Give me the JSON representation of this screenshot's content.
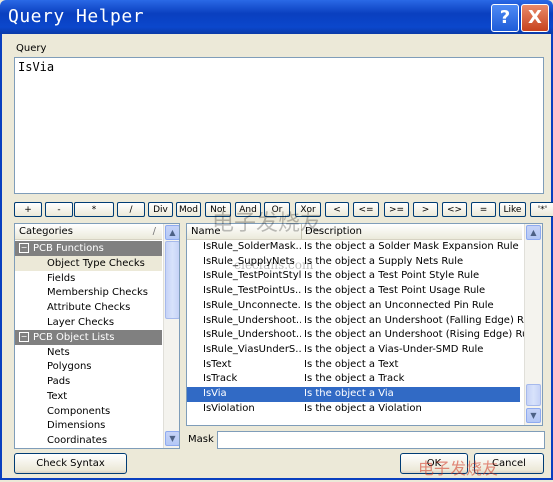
{
  "window": {
    "title": "Query Helper",
    "help_glyph": "?",
    "close_glyph": "X"
  },
  "query": {
    "label": "Query",
    "value": "IsVia"
  },
  "operators": [
    "+",
    "-",
    "*",
    "/",
    "Div",
    "Mod",
    "Not",
    "And",
    "Or",
    "Xor",
    "<",
    "<=",
    ">=",
    ">",
    "<>",
    "=",
    "Like",
    "'*'"
  ],
  "categories": {
    "header": "Categories",
    "groups": [
      {
        "label": "PCB Functions",
        "expander": "−",
        "items": [
          "Object Type Checks",
          "Fields",
          "Membership Checks",
          "Attribute Checks",
          "Layer Checks"
        ]
      },
      {
        "label": "PCB Object Lists",
        "expander": "−",
        "items": [
          "Nets",
          "Polygons",
          "Pads",
          "Text",
          "Components",
          "Dimensions",
          "Coordinates"
        ]
      }
    ],
    "selected": "Object Type Checks"
  },
  "functions": {
    "col_name": "Name",
    "col_desc": "Description",
    "rows": [
      {
        "name": "IsRule_SolderMask...",
        "desc": "Is the object a Solder Mask Expansion Rule"
      },
      {
        "name": "IsRule_SupplyNets",
        "desc": "Is the object a Supply Nets Rule"
      },
      {
        "name": "IsRule_TestPointStyle",
        "desc": "Is the object a Test Point Style Rule"
      },
      {
        "name": "IsRule_TestPointUs...",
        "desc": "Is the object a Test Point Usage Rule"
      },
      {
        "name": "IsRule_Unconnecte...",
        "desc": "Is the object an Unconnected Pin Rule"
      },
      {
        "name": "IsRule_Undershoot...",
        "desc": "Is the object an Undershoot (Falling Edge) Rule"
      },
      {
        "name": "IsRule_Undershoot...",
        "desc": "Is the object an Undershoot (Rising Edge) Rule"
      },
      {
        "name": "IsRule_ViasUnderS...",
        "desc": "Is the object a Vias-Under-SMD Rule"
      },
      {
        "name": "IsText",
        "desc": "Is the object a Text"
      },
      {
        "name": "IsTrack",
        "desc": "Is the object a Track"
      },
      {
        "name": "IsVia",
        "desc": "Is the object a Via"
      },
      {
        "name": "IsViolation",
        "desc": "Is the object a Violation"
      }
    ],
    "selected_index": 10
  },
  "mask": {
    "label": "Mask",
    "value": ""
  },
  "buttons": {
    "check_syntax": "Check Syntax",
    "ok": "OK",
    "cancel": "Cancel"
  },
  "icons": {
    "scroll_up": "up-arrow-icon",
    "scroll_down": "down-arrow-icon",
    "dropdown": "chevron-down-icon"
  },
  "colors": {
    "title_bar": "#0a3fbf",
    "selection": "#316ac5",
    "group_header": "#808080",
    "window_bg": "#ece9d8"
  }
}
